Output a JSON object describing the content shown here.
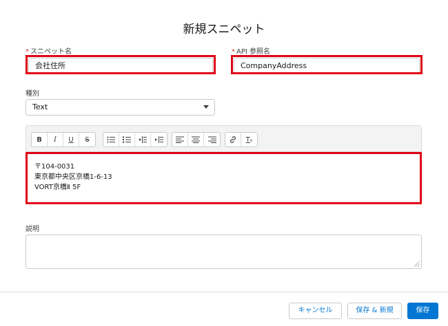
{
  "modal": {
    "title": "新規スニペット"
  },
  "form": {
    "snippet_name": {
      "required_mark": "*",
      "label": "スニペット名",
      "value": "会社住所"
    },
    "api_name": {
      "required_mark": "*",
      "label": "API 参照名",
      "value": "CompanyAddress"
    },
    "type": {
      "label": "種別",
      "selected": "Text"
    },
    "body": {
      "lines": [
        "〒104-0031",
        "東京都中央区京橋1-6-13",
        "VORT京橋Ⅱ 5F"
      ]
    },
    "description": {
      "label": "説明",
      "value": ""
    }
  },
  "toolbar": {
    "bold": "B",
    "italic": "I",
    "underline": "U",
    "strike": "S",
    "clear_format": "T"
  },
  "footer": {
    "cancel_label": "キャンセル",
    "save_new_label": "保存 & 新規",
    "save_label": "保存"
  },
  "colors": {
    "highlight": "#e00016",
    "brand": "#0176d3",
    "required": "#c23934"
  }
}
